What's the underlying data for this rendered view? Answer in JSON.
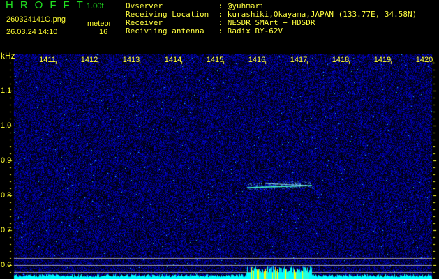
{
  "header": {
    "logo": "HROFFT",
    "version": "1.00f",
    "filename": "260324141O.png",
    "datetime": "26.03.24 14:10",
    "mode_label": "meteor",
    "count": "16"
  },
  "info": [
    {
      "label": "Ovserver            : ",
      "value": "@yuhmari"
    },
    {
      "label": "Receiving Location  : ",
      "value": "kurashiki,Okayama,JAPAN (133.77E, 34.58N)"
    },
    {
      "label": "Receiver            : ",
      "value": "NESDR SMArt + HDSDR"
    },
    {
      "label": "Reciviing antenna   : ",
      "value": "Radix RY-62V"
    }
  ],
  "axis": {
    "unit": "kHz",
    "x_ticks": [
      "1411",
      "1412",
      "1413",
      "1414",
      "1415",
      "1416",
      "1417",
      "1418",
      "1419",
      "1420"
    ],
    "y_ticks": [
      "1.1",
      "1.0",
      "0.9",
      "0.8",
      "0.7",
      "0.6"
    ]
  },
  "colors": {
    "text": "#ffff30",
    "logo": "#20e020",
    "noise": "#1010c0",
    "spectrum": "#00ffff",
    "peak": "#ffff00"
  }
}
